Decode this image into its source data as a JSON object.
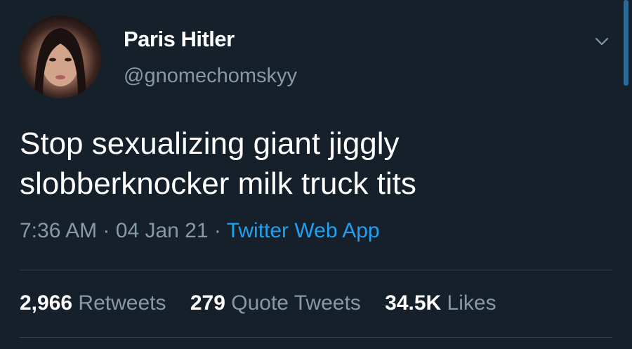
{
  "user": {
    "display_name": "Paris Hitler",
    "handle": "@gnomechomskyy",
    "avatar": "avatar-photo"
  },
  "tweet": {
    "text": "Stop sexualizing giant jiggly slobberknocker milk truck tits",
    "time": "7:36 AM",
    "date": "04 Jan 21",
    "separator": "·",
    "source": "Twitter Web App"
  },
  "stats": {
    "retweets_count": "2,966",
    "retweets_label": "Retweets",
    "quotes_count": "279",
    "quotes_label": "Quote Tweets",
    "likes_count": "34.5K",
    "likes_label": "Likes"
  },
  "icons": {
    "menu": "chevron-down-icon"
  },
  "colors": {
    "background": "#15202b",
    "primary_text": "#ffffff",
    "secondary_text": "#8899a6",
    "link": "#1da1f2",
    "divider": "#38444d"
  }
}
